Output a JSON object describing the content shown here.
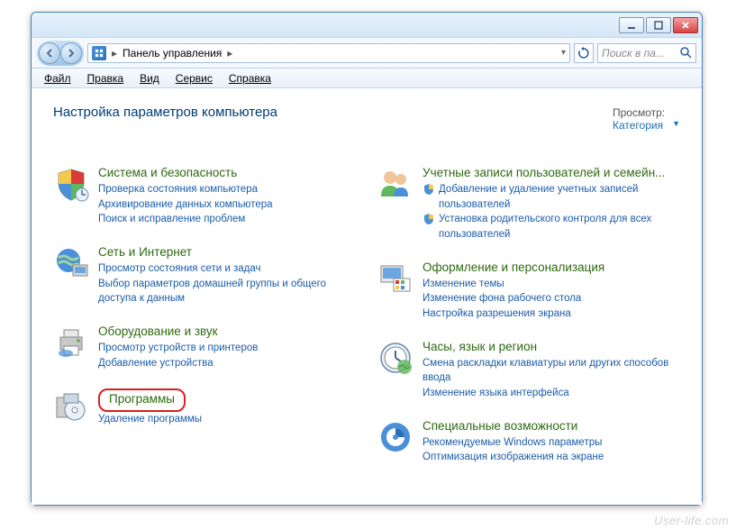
{
  "window": {
    "breadcrumb_root": "Панель управления",
    "search_placeholder": "Поиск в па..."
  },
  "menu": {
    "file": "Файл",
    "edit": "Правка",
    "view": "Вид",
    "tools": "Сервис",
    "help": "Справка"
  },
  "header": {
    "title": "Настройка параметров компьютера",
    "viewby_label": "Просмотр:",
    "viewby_value": "Категория"
  },
  "categories": {
    "system": {
      "title": "Система и безопасность",
      "links": [
        "Проверка состояния компьютера",
        "Архивирование данных компьютера",
        "Поиск и исправление проблем"
      ]
    },
    "network": {
      "title": "Сеть и Интернет",
      "links": [
        "Просмотр состояния сети и задач",
        "Выбор параметров домашней группы и общего доступа к данным"
      ]
    },
    "hardware": {
      "title": "Оборудование и звук",
      "links": [
        "Просмотр устройств и принтеров",
        "Добавление устройства"
      ]
    },
    "programs": {
      "title": "Программы",
      "links": [
        "Удаление программы"
      ]
    },
    "accounts": {
      "title": "Учетные записи пользователей и семейн...",
      "links": [
        "Добавление и удаление учетных записей пользователей",
        "Установка родительского контроля для всех пользователей"
      ]
    },
    "appearance": {
      "title": "Оформление и персонализация",
      "links": [
        "Изменение темы",
        "Изменение фона рабочего стола",
        "Настройка разрешения экрана"
      ]
    },
    "clock": {
      "title": "Часы, язык и регион",
      "links": [
        "Смена раскладки клавиатуры или других способов ввода",
        "Изменение языка интерфейса"
      ]
    },
    "access": {
      "title": "Специальные возможности",
      "links": [
        "Рекомендуемые Windows параметры",
        "Оптимизация изображения на экране"
      ]
    }
  },
  "watermark": "User-life.com"
}
